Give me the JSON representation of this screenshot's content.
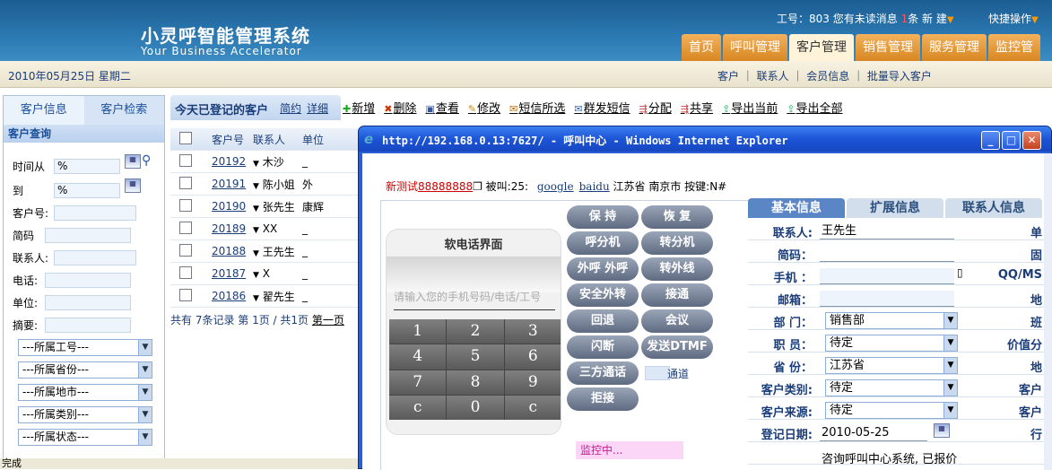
{
  "header": {
    "title_cn": "小灵呼智能管理系统",
    "title_en": "Your Business Accelerator",
    "user_info_prefix": "工号：803 您有未读消息",
    "msg_count": "1",
    "user_info_suffix": "条 新",
    "build": "建",
    "quick_ops": "快捷操作",
    "nav": [
      {
        "label": "首页"
      },
      {
        "label": "呼叫管理"
      },
      {
        "label": "客户管理"
      },
      {
        "label": "销售管理"
      },
      {
        "label": "服务管理"
      },
      {
        "label": "监控管"
      }
    ]
  },
  "subbar": {
    "date": "2010年05月25日 星期二",
    "links": "客户 ｜ 联系人 ｜ 会员信息 ｜ 批量导入客户"
  },
  "left": {
    "tab1": "客户信息",
    "tab2": "客户检索",
    "section": "客户查询",
    "time_from": "时间从",
    "time_from_val": "%",
    "to": "到",
    "to_val": "%",
    "cust_no": "客户号:",
    "code": "简码",
    "contact": "联系人:",
    "phone": "电话:",
    "unit": "单位:",
    "summary": "摘要:",
    "selects": [
      "---所属工号---",
      "---所属省份---",
      "---所属地市---",
      "---所属类别---",
      "---所属状态---"
    ]
  },
  "center": {
    "title": "今天已登记的客户",
    "simple": "简约",
    "detail": "详细",
    "toolbar": [
      {
        "icon": "✚",
        "label": "新增"
      },
      {
        "icon": "✖",
        "label": "删除"
      },
      {
        "icon": "▣",
        "label": "查看"
      },
      {
        "icon": "✎",
        "label": "修改"
      },
      {
        "icon": "✉",
        "label": "短信所选"
      },
      {
        "icon": "✉",
        "label": "群发短信"
      },
      {
        "icon": "⇶",
        "label": "分配"
      },
      {
        "icon": "⇶",
        "label": "共享"
      },
      {
        "icon": "⇪",
        "label": "导出当前"
      },
      {
        "icon": "⇪",
        "label": "导出全部"
      }
    ],
    "columns": [
      "客户号",
      "联系人",
      "单位"
    ],
    "rows": [
      {
        "no": "20192",
        "name": "木沙",
        "unit": "_"
      },
      {
        "no": "20191",
        "name": "陈小姐",
        "unit": "外"
      },
      {
        "no": "20190",
        "name": "张先生",
        "unit": "康辉"
      },
      {
        "no": "20189",
        "name": "XX",
        "unit": "_"
      },
      {
        "no": "20188",
        "name": "王先生",
        "unit": "_"
      },
      {
        "no": "20187",
        "name": "X",
        "unit": "_"
      },
      {
        "no": "20186",
        "name": "翟先生",
        "unit": "_"
      }
    ],
    "pager": "共有 7条记录  第 1页 / 共1页 ",
    "pager_link": "第一页"
  },
  "status": "完成",
  "ie": {
    "title": "http://192.168.0.13:7627/ - 呼叫中心 - Windows Internet Explorer",
    "test_prefix": "新测试",
    "test_num": "88888888",
    "called": " 被叫:25: ",
    "google": "google",
    "baidu": "baidu",
    "region": " 江苏省  南京市  按键:N#",
    "phone_title": "软电话界面",
    "phone_placeholder": "请输入您的手机号码/电话/工号",
    "keys": [
      "1",
      "2",
      "3",
      "4",
      "5",
      "6",
      "7",
      "8",
      "9",
      "c",
      "0",
      "c"
    ],
    "buttons": [
      [
        "保  持",
        "恢  复"
      ],
      [
        "呼分机",
        "转分机"
      ],
      [
        "外呼 外呼",
        "转外线"
      ],
      [
        "安全外转",
        "接通"
      ],
      [
        "回退",
        "会议"
      ],
      [
        "闪断",
        "发送DTMF"
      ],
      [
        "三方通话",
        ""
      ],
      [
        "拒接",
        ""
      ]
    ],
    "channel": "通道",
    "monitor": "监控中...",
    "rtabs": [
      "基本信息",
      "扩展信息",
      "联系人信息"
    ],
    "labels": [
      "联系人:",
      "简码：",
      "手机 ：",
      "邮箱：",
      "部 门：",
      "职 员：",
      "省 份：",
      "客户类别:",
      "客户来源:",
      "登记日期:"
    ],
    "values": {
      "contact": "王先生",
      "dept": "销售部",
      "staff": "待定",
      "province": "江苏省",
      "category": "待定",
      "source": "待定",
      "date": "2010-05-25"
    },
    "right_labels": [
      "单",
      "固",
      "QQ/MS",
      "地",
      "班",
      "价值分",
      "地",
      "客户",
      "客户",
      "行"
    ],
    "footer": "咨询呼叫中心系统, 已报价"
  }
}
